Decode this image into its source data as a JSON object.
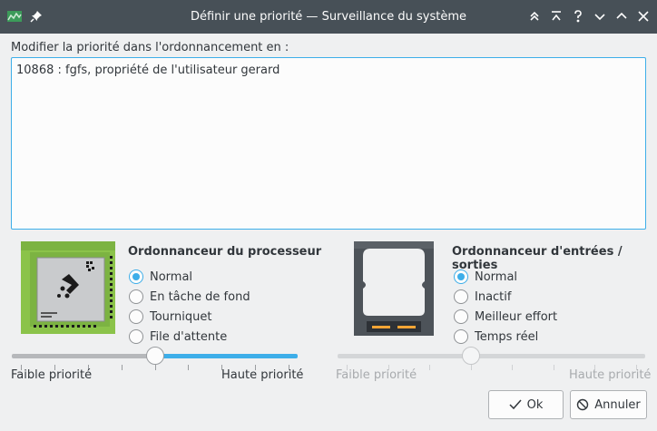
{
  "window": {
    "title": "Définir une priorité — Surveillance du système",
    "icons": [
      "system-monitor-icon",
      "pin-icon",
      "keep-above-icon",
      "keep-below-icon",
      "help-icon",
      "minimize-icon",
      "maximize-icon"
    ]
  },
  "prompt": "Modifier la priorité dans l'ordonnancement en :",
  "process_text": "10868 : fgfs, propriété de l'utilisateur gerard",
  "cpu": {
    "title": "Ordonnanceur du processeur",
    "options": [
      "Normal",
      "En tâche de fond",
      "Tourniquet",
      "File d'attente"
    ],
    "selected": "Normal",
    "slider": {
      "low_label": "Faible priorité",
      "high_label": "Haute priorité",
      "value_fraction": 0.5,
      "enabled": true
    }
  },
  "io": {
    "title": "Ordonnanceur d'entrées / sorties",
    "options": [
      "Normal",
      "Inactif",
      "Meilleur effort",
      "Temps réel"
    ],
    "selected": "Normal",
    "slider": {
      "low_label": "Faible priorité",
      "high_label": "Haute priorité",
      "value_fraction": 0.43,
      "enabled": false
    }
  },
  "buttons": {
    "ok": "Ok",
    "cancel": "Annuler"
  },
  "colors": {
    "accent": "#3daee9",
    "titlebar": "#475057",
    "background": "#eff0f1",
    "chip_green": "#8bc34a"
  }
}
